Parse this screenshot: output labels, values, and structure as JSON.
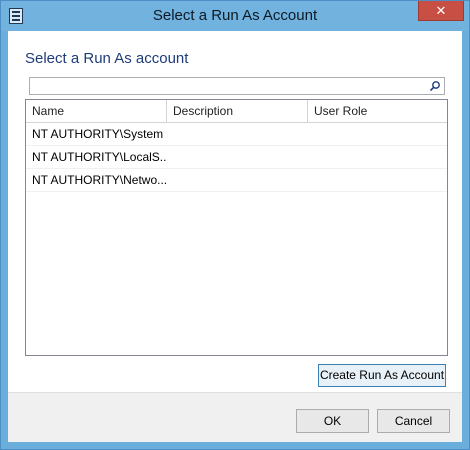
{
  "window": {
    "title": "Select a Run As Account",
    "close_label": "✕"
  },
  "main": {
    "heading": "Select a Run As account",
    "search": {
      "value": "",
      "placeholder": ""
    },
    "table": {
      "columns": [
        "Name",
        "Description",
        "User Role"
      ],
      "rows": [
        {
          "name": "NT AUTHORITY\\System",
          "description": "",
          "role": ""
        },
        {
          "name": "NT AUTHORITY\\LocalS...",
          "description": "",
          "role": ""
        },
        {
          "name": "NT AUTHORITY\\Netwo...",
          "description": "",
          "role": ""
        }
      ]
    },
    "create_button": "Create Run As Account"
  },
  "footer": {
    "ok_label": "OK",
    "cancel_label": "Cancel"
  },
  "colors": {
    "title_bar": "#71b2de",
    "close_button": "#c74f44",
    "heading": "#1e3c7a",
    "footer": "#f0f0f0"
  }
}
